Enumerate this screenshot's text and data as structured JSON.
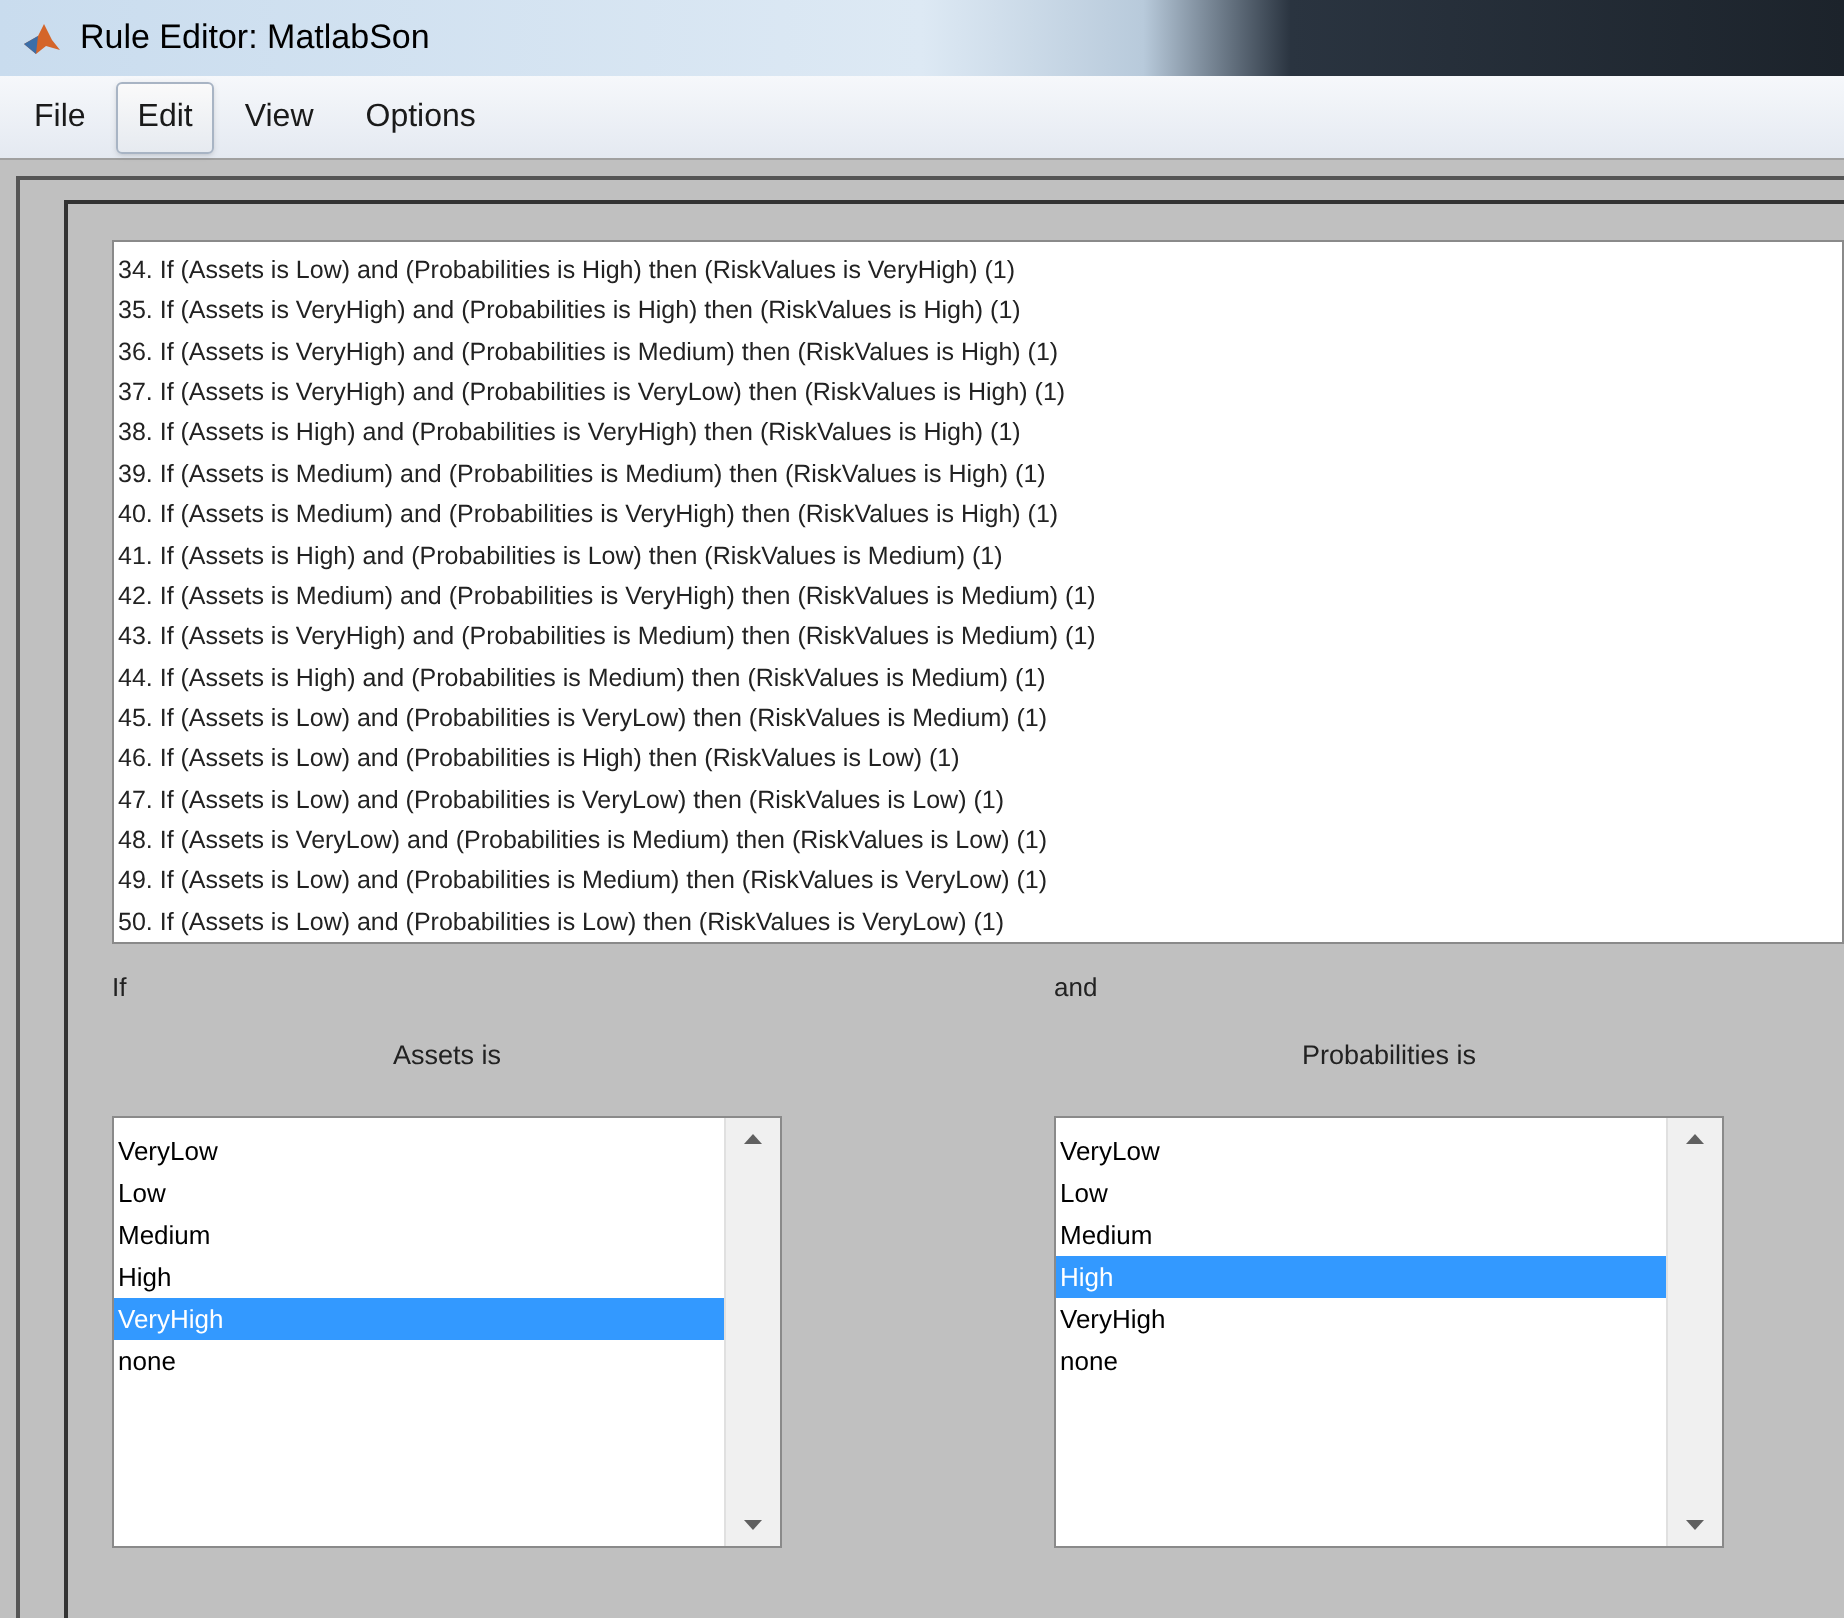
{
  "window": {
    "title": "Rule Editor: MatlabSon"
  },
  "menu": [
    {
      "label": "File",
      "highlighted": false
    },
    {
      "label": "Edit",
      "highlighted": true
    },
    {
      "label": "View",
      "highlighted": false
    },
    {
      "label": "Options",
      "highlighted": false
    }
  ],
  "rules": [
    "34. If (Assets is Low) and (Probabilities is High) then (RiskValues is VeryHigh) (1)",
    "35. If (Assets is VeryHigh) and (Probabilities is High) then (RiskValues is High) (1)",
    "36. If (Assets is VeryHigh) and (Probabilities is Medium) then (RiskValues is High) (1)",
    "37. If (Assets is VeryHigh) and (Probabilities is VeryLow) then (RiskValues is High) (1)",
    "38. If (Assets is High) and (Probabilities is VeryHigh) then (RiskValues is High) (1)",
    "39. If (Assets is Medium) and (Probabilities is Medium) then (RiskValues is High) (1)",
    "40. If (Assets is Medium) and (Probabilities is VeryHigh) then (RiskValues is High) (1)",
    "41. If (Assets is High) and (Probabilities is Low) then (RiskValues is Medium) (1)",
    "42. If (Assets is Medium) and (Probabilities is VeryHigh) then (RiskValues is Medium) (1)",
    "43. If (Assets is VeryHigh) and (Probabilities is Medium) then (RiskValues is Medium) (1)",
    "44. If (Assets is High) and (Probabilities is Medium) then (RiskValues is Medium) (1)",
    "45. If (Assets is Low) and (Probabilities is VeryLow) then (RiskValues is Medium) (1)",
    "46. If (Assets is Low) and (Probabilities is High) then (RiskValues is Low) (1)",
    "47. If (Assets is Low) and (Probabilities is VeryLow) then (RiskValues is Low) (1)",
    "48. If (Assets is VeryLow) and (Probabilities is Medium) then (RiskValues is Low) (1)",
    "49. If (Assets is Low) and (Probabilities is Medium) then (RiskValues is VeryLow) (1)",
    "50. If (Assets is Low) and (Probabilities is Low) then (RiskValues is VeryLow) (1)"
  ],
  "conditions": [
    {
      "connective": "If",
      "heading": "Assets is",
      "options": [
        {
          "label": "VeryLow",
          "selected": false
        },
        {
          "label": "Low",
          "selected": false
        },
        {
          "label": "Medium",
          "selected": false
        },
        {
          "label": "High",
          "selected": false
        },
        {
          "label": "VeryHigh",
          "selected": true
        },
        {
          "label": "none",
          "selected": false
        }
      ]
    },
    {
      "connective": "and",
      "heading": "Probabilities is",
      "options": [
        {
          "label": "VeryLow",
          "selected": false
        },
        {
          "label": "Low",
          "selected": false
        },
        {
          "label": "Medium",
          "selected": false
        },
        {
          "label": "High",
          "selected": true
        },
        {
          "label": "VeryHigh",
          "selected": false
        },
        {
          "label": "none",
          "selected": false
        }
      ]
    }
  ]
}
